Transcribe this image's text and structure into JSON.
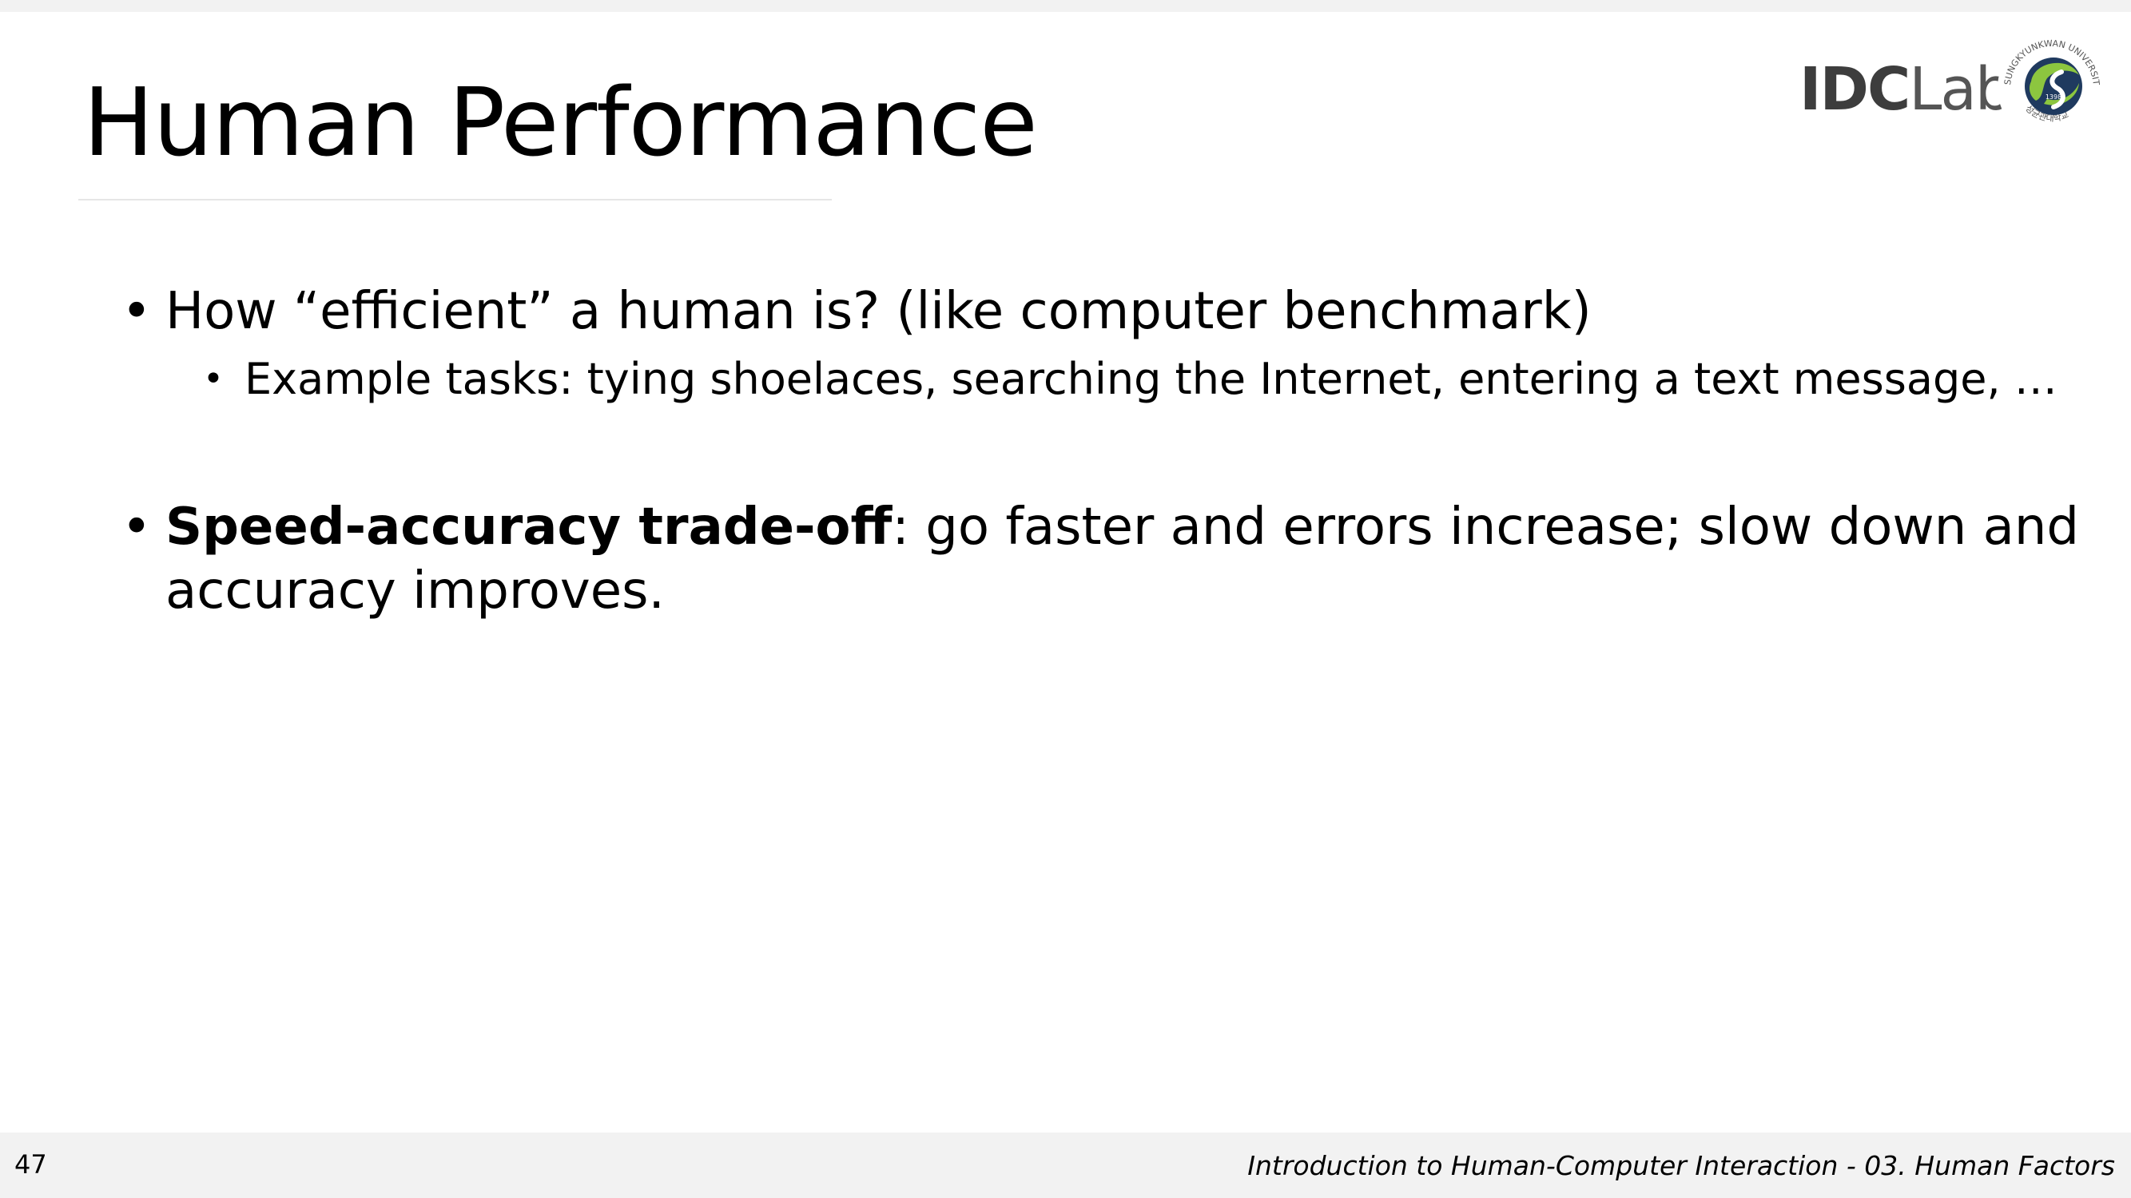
{
  "slide": {
    "title": "Human Performance",
    "bullets": [
      {
        "text": "How “efficient” a human is? (like computer benchmark)"
      },
      {
        "text": "Example tasks: tying shoelaces, searching the Internet, entering a text message, …"
      },
      {
        "bold": "Speed-accuracy trade-off",
        "rest": ": go faster and errors increase; slow down and accuracy improves."
      }
    ],
    "bullet_char": "•"
  },
  "logos": {
    "lab_part1": "IDC",
    "lab_part2": "Lab",
    "university_seal_text": "SUNGKYUNKWAN UNIVERSITY",
    "university_seal_year": "1398",
    "university_seal_korean": "성균관대학교",
    "seal_green": "#8cc63f",
    "seal_dark": "#1f3a5f"
  },
  "footer": {
    "page_number": "47",
    "course": "Introduction to Human-Computer Interaction - 03. Human Factors"
  }
}
